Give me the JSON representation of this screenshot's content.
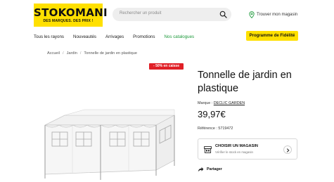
{
  "header": {
    "logo_main": "STOKOMANI",
    "logo_sub": "DES MARQUES. DES PRIX !",
    "search_placeholder": "Rechercher un produit",
    "store_label": "Trouver mon magasin"
  },
  "nav": {
    "items": [
      "Tous les rayons",
      "Nouveautés",
      "Arrivages",
      "Promotions",
      "Nos catalogues"
    ],
    "loyalty_label": "Programme de Fidélité"
  },
  "breadcrumb": [
    "Accueil",
    "Jardin",
    "Tonnelle de jardin en plastique"
  ],
  "product": {
    "badge": "- 50% en caisse",
    "title": "Tonnelle de jardin en plastique",
    "brand_prefix": "Marque : ",
    "brand": "DECLIC GARDEN",
    "price": "39,97€",
    "reference": "Référence : 5719472",
    "store_card_title": "CHOISIR UN MAGASIN",
    "store_card_sub": "Vérifier le stock en magasin",
    "share_label": "Partager"
  },
  "colors": {
    "brand_yellow": "#ffe000",
    "badge_red": "#e01f26",
    "catalog_green": "#1e9a3c"
  },
  "icons": [
    "search-icon",
    "map-pin-icon",
    "shop-icon",
    "chevron-right-icon",
    "share-icon"
  ]
}
